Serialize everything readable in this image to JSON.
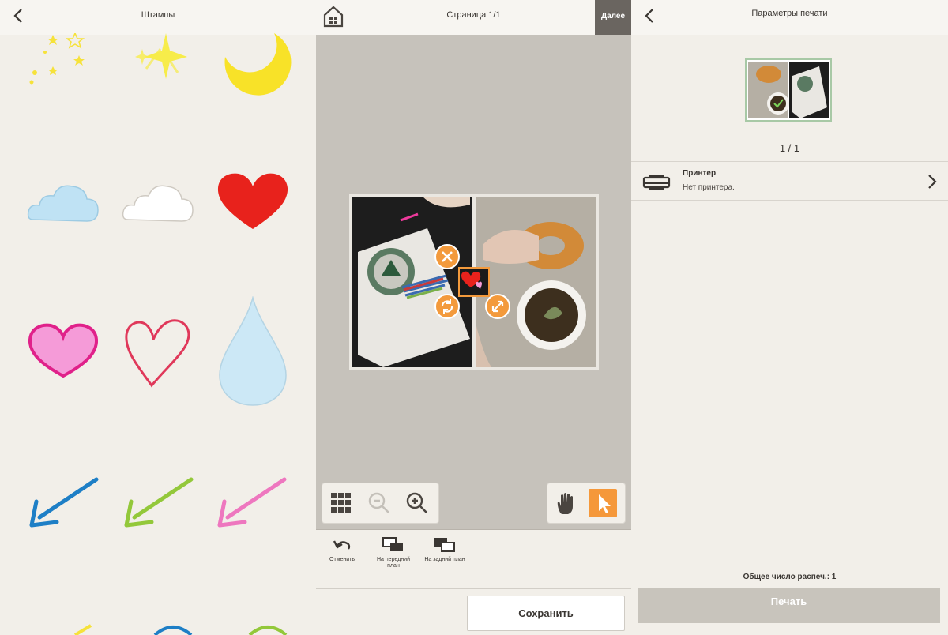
{
  "stamps_panel": {
    "title": "Штампы",
    "stamps": [
      {
        "name": "stars"
      },
      {
        "name": "sparkle"
      },
      {
        "name": "moon"
      },
      {
        "name": "cloud-blue"
      },
      {
        "name": "cloud-white"
      },
      {
        "name": "heart-red"
      },
      {
        "name": "heart-pink"
      },
      {
        "name": "heart-outline"
      },
      {
        "name": "drop"
      },
      {
        "name": "arrow-blue"
      },
      {
        "name": "arrow-green"
      },
      {
        "name": "arrow-pink"
      }
    ]
  },
  "editor": {
    "title": "Страница 1/1",
    "next_label": "Далее",
    "tools": {
      "undo_label": "Отменить",
      "front_label": "На передний план",
      "back_label": "На задний план"
    },
    "save_label": "Сохранить"
  },
  "print_panel": {
    "title": "Параметры печати",
    "page_counter": "1 / 1",
    "printer_title": "Принтер",
    "printer_status": "Нет принтера.",
    "total_label": "Общее число распеч.: 1",
    "print_label": "Печать"
  },
  "colors": {
    "accent": "#f39a3c",
    "background": "#f2efe9",
    "canvas": "#c6c2bb",
    "print_disabled": "#c8c4bc"
  }
}
